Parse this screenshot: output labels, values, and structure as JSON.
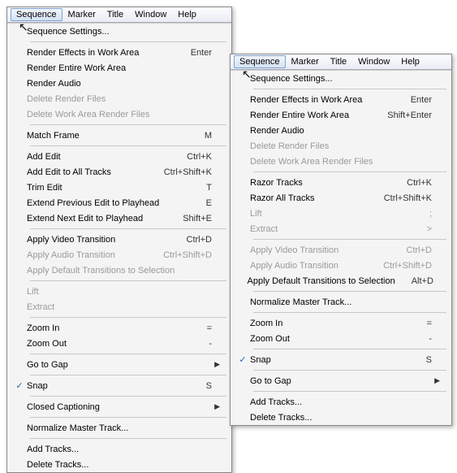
{
  "menubar": {
    "items": [
      "Sequence",
      "Marker",
      "Title",
      "Window",
      "Help"
    ]
  },
  "leftMenu": {
    "groups": [
      [
        {
          "label": "Sequence Settings...",
          "shortcut": "",
          "disabled": false
        }
      ],
      [
        {
          "label": "Render Effects in Work Area",
          "shortcut": "Enter",
          "disabled": false
        },
        {
          "label": "Render Entire Work Area",
          "shortcut": "",
          "disabled": false
        },
        {
          "label": "Render Audio",
          "shortcut": "",
          "disabled": false
        },
        {
          "label": "Delete Render Files",
          "shortcut": "",
          "disabled": true
        },
        {
          "label": "Delete Work Area Render Files",
          "shortcut": "",
          "disabled": true
        }
      ],
      [
        {
          "label": "Match Frame",
          "shortcut": "M",
          "disabled": false
        }
      ],
      [
        {
          "label": "Add Edit",
          "shortcut": "Ctrl+K",
          "disabled": false
        },
        {
          "label": "Add Edit to All Tracks",
          "shortcut": "Ctrl+Shift+K",
          "disabled": false
        },
        {
          "label": "Trim Edit",
          "shortcut": "T",
          "disabled": false
        },
        {
          "label": "Extend Previous Edit to Playhead",
          "shortcut": "E",
          "disabled": false
        },
        {
          "label": "Extend Next Edit to Playhead",
          "shortcut": "Shift+E",
          "disabled": false
        }
      ],
      [
        {
          "label": "Apply Video Transition",
          "shortcut": "Ctrl+D",
          "disabled": false
        },
        {
          "label": "Apply Audio Transition",
          "shortcut": "Ctrl+Shift+D",
          "disabled": true
        },
        {
          "label": "Apply Default Transitions to Selection",
          "shortcut": "",
          "disabled": true
        }
      ],
      [
        {
          "label": "Lift",
          "shortcut": "",
          "disabled": true
        },
        {
          "label": "Extract",
          "shortcut": "",
          "disabled": true
        }
      ],
      [
        {
          "label": "Zoom In",
          "shortcut": "=",
          "disabled": false
        },
        {
          "label": "Zoom Out",
          "shortcut": "-",
          "disabled": false
        }
      ],
      [
        {
          "label": "Go to Gap",
          "shortcut": "",
          "disabled": false,
          "submenu": true
        }
      ],
      [
        {
          "label": "Snap",
          "shortcut": "S",
          "disabled": false,
          "checked": true
        }
      ],
      [
        {
          "label": "Closed Captioning",
          "shortcut": "",
          "disabled": false,
          "submenu": true
        }
      ],
      [
        {
          "label": "Normalize Master Track...",
          "shortcut": "",
          "disabled": false
        }
      ],
      [
        {
          "label": "Add Tracks...",
          "shortcut": "",
          "disabled": false
        },
        {
          "label": "Delete Tracks...",
          "shortcut": "",
          "disabled": false
        }
      ]
    ]
  },
  "rightMenu": {
    "groups": [
      [
        {
          "label": "Sequence Settings...",
          "shortcut": "",
          "disabled": false
        }
      ],
      [
        {
          "label": "Render Effects in Work Area",
          "shortcut": "Enter",
          "disabled": false
        },
        {
          "label": "Render Entire Work Area",
          "shortcut": "Shift+Enter",
          "disabled": false
        },
        {
          "label": "Render Audio",
          "shortcut": "",
          "disabled": false
        },
        {
          "label": "Delete Render Files",
          "shortcut": "",
          "disabled": true
        },
        {
          "label": "Delete Work Area Render Files",
          "shortcut": "",
          "disabled": true
        }
      ],
      [
        {
          "label": "Razor Tracks",
          "shortcut": "Ctrl+K",
          "disabled": false
        },
        {
          "label": "Razor All Tracks",
          "shortcut": "Ctrl+Shift+K",
          "disabled": false
        },
        {
          "label": "Lift",
          "shortcut": ";",
          "disabled": true
        },
        {
          "label": "Extract",
          "shortcut": ">",
          "disabled": true
        }
      ],
      [
        {
          "label": "Apply Video Transition",
          "shortcut": "Ctrl+D",
          "disabled": true
        },
        {
          "label": "Apply Audio Transition",
          "shortcut": "Ctrl+Shift+D",
          "disabled": true
        },
        {
          "label": "Apply Default Transitions to Selection",
          "shortcut": "Alt+D",
          "disabled": false
        }
      ],
      [
        {
          "label": "Normalize Master Track...",
          "shortcut": "",
          "disabled": false
        }
      ],
      [
        {
          "label": "Zoom In",
          "shortcut": "=",
          "disabled": false
        },
        {
          "label": "Zoom Out",
          "shortcut": "-",
          "disabled": false
        }
      ],
      [
        {
          "label": "Snap",
          "shortcut": "S",
          "disabled": false,
          "checked": true
        }
      ],
      [
        {
          "label": "Go to Gap",
          "shortcut": "",
          "disabled": false,
          "submenu": true
        }
      ],
      [
        {
          "label": "Add Tracks...",
          "shortcut": "",
          "disabled": false
        },
        {
          "label": "Delete Tracks...",
          "shortcut": "",
          "disabled": false
        }
      ]
    ]
  }
}
